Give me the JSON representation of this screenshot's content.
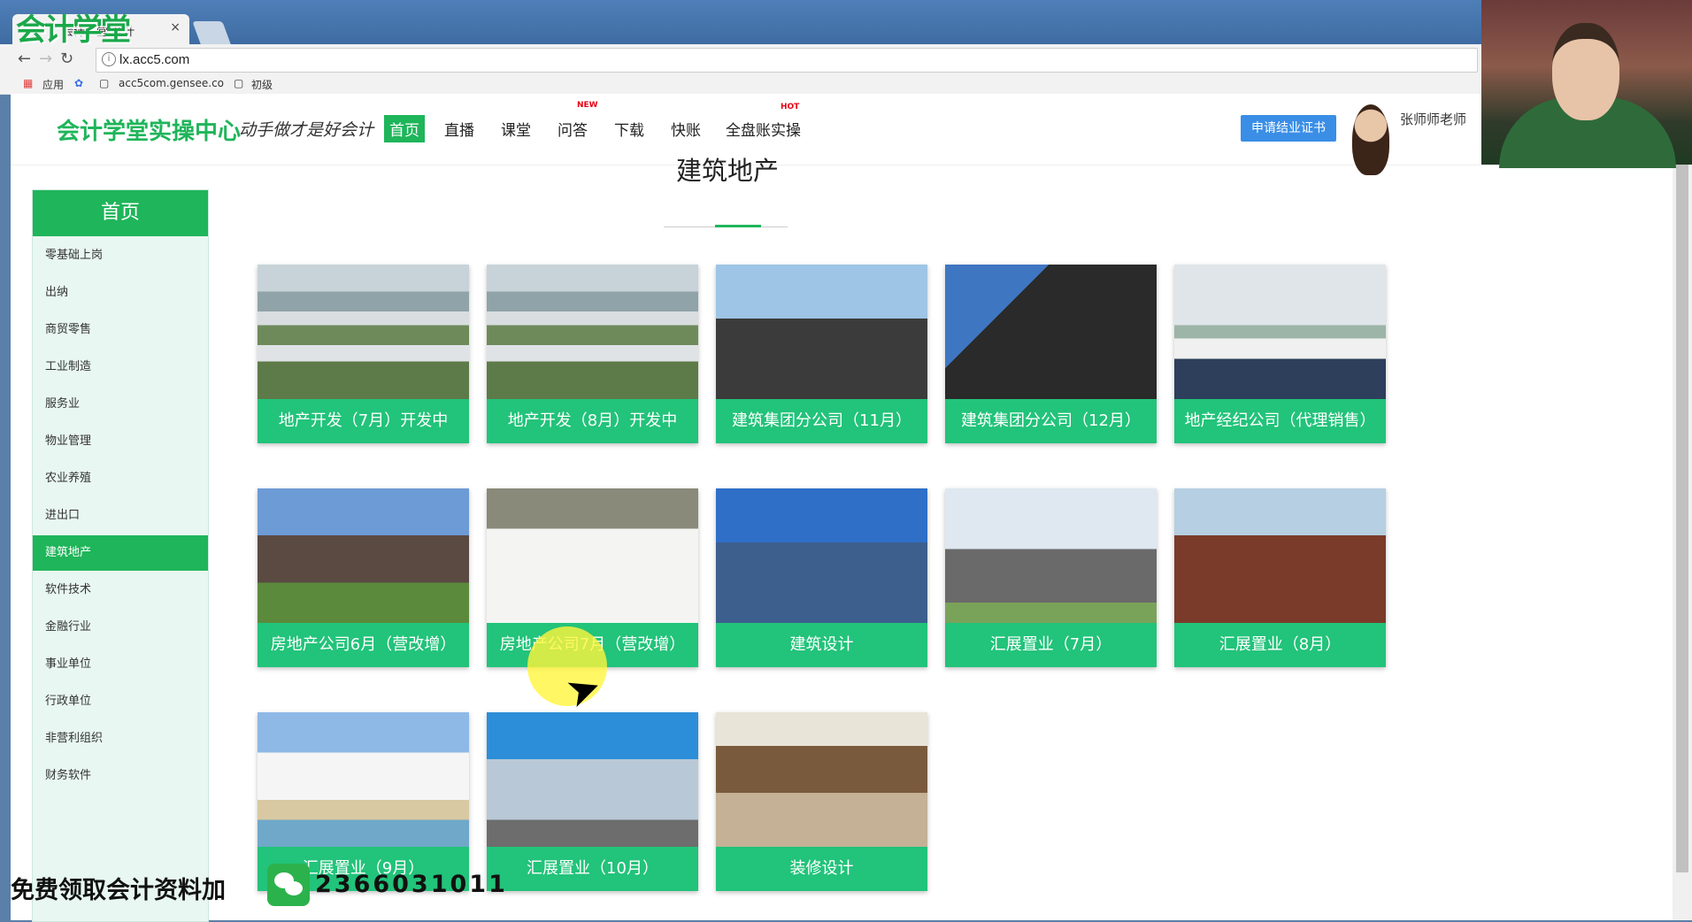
{
  "browser": {
    "tab_title": "会计学堂 会计",
    "tab_close": "×",
    "url": "lx.acc5.com",
    "bookmarks": [
      "应用",
      "acc5com.gensee.co",
      "初级"
    ],
    "logo_overlay": "会计学堂"
  },
  "header": {
    "brand": "会计学堂实操中心",
    "slogan": "动手做才是好会计",
    "nav": [
      {
        "label": "首页",
        "active": true
      },
      {
        "label": "直播"
      },
      {
        "label": "课堂"
      },
      {
        "label": "问答",
        "badge": "NEW"
      },
      {
        "label": "下载"
      },
      {
        "label": "快账"
      },
      {
        "label": "全盘账实操",
        "badge": "HOT"
      }
    ],
    "apply_button": "申请结业证书",
    "username": "张师师老师"
  },
  "sidebar": {
    "title": "首页",
    "items": [
      "零基础上岗",
      "出纳",
      "商贸零售",
      "工业制造",
      "服务业",
      "物业管理",
      "农业养殖",
      "进出口",
      "建筑地产",
      "软件技术",
      "金融行业",
      "事业单位",
      "行政单位",
      "非营利组织",
      "财务软件"
    ],
    "active_index": 8
  },
  "main": {
    "title": "建筑地产",
    "cards": [
      {
        "label": "地产开发（7月）开发中",
        "image": "aerial-residential"
      },
      {
        "label": "地产开发（8月）开发中",
        "image": "aerial-residential"
      },
      {
        "label": "建筑集团分公司（11月）",
        "image": "crane-construction"
      },
      {
        "label": "建筑集团分公司（12月）",
        "image": "steel-frame"
      },
      {
        "label": "地产经纪公司（代理销售）",
        "image": "office-team"
      },
      {
        "label": "房地产公司6月（营改增）",
        "image": "house"
      },
      {
        "label": "房地产公司7月（营改增）",
        "image": "living-room"
      },
      {
        "label": "建筑设计",
        "image": "glass-tower"
      },
      {
        "label": "汇展置业（7月）",
        "image": "commercial-building"
      },
      {
        "label": "汇展置业（8月）",
        "image": "brick-towers"
      },
      {
        "label": "汇展置业（9月）",
        "image": "beach-resort"
      },
      {
        "label": "汇展置业（10月）",
        "image": "curved-glass-tower"
      },
      {
        "label": "装修设计",
        "image": "interior-design"
      }
    ]
  },
  "promo": {
    "text": "免费领取会计资料加",
    "number": "2366031011"
  }
}
